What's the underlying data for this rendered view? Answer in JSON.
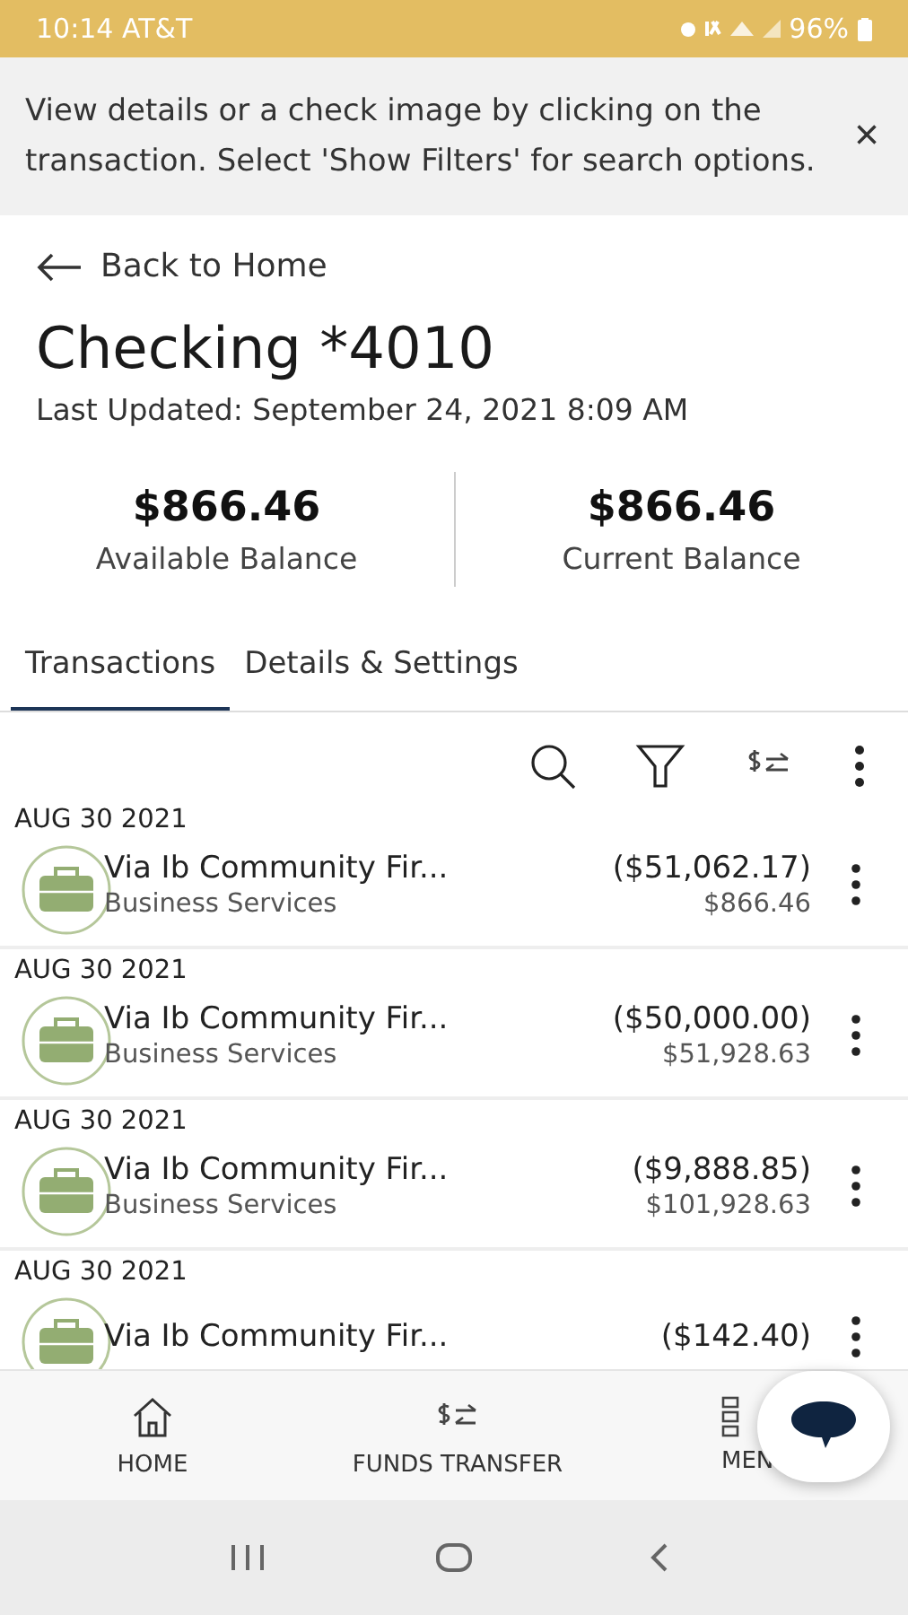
{
  "status_bar": {
    "time": "10:14 AT&T",
    "battery": "96%"
  },
  "banner": {
    "text": "View details or a check image by clicking on the transaction. Select 'Show Filters' for search options.",
    "close": "×"
  },
  "back": {
    "label": "Back to Home"
  },
  "account": {
    "title": "Checking *4010",
    "updated": "Last Updated: September 24, 2021 8:09 AM"
  },
  "balances": [
    {
      "amount": "$866.46",
      "label": "Available Balance"
    },
    {
      "amount": "$866.46",
      "label": "Current Balance"
    }
  ],
  "tabs": [
    {
      "label": "Transactions",
      "selected": true
    },
    {
      "label": "Details & Settings",
      "selected": false
    }
  ],
  "transactions": [
    {
      "date": "AUG 30 2021",
      "name": "Via Ib Community Fir...",
      "amount": "($51,062.17)",
      "category": "Business Services",
      "balance": "$866.46"
    },
    {
      "date": "AUG 30 2021",
      "name": "Via Ib Community Fir...",
      "amount": "($50,000.00)",
      "category": "Business Services",
      "balance": "$51,928.63"
    },
    {
      "date": "AUG 30 2021",
      "name": "Via Ib Community Fir...",
      "amount": "($9,888.85)",
      "category": "Business Services",
      "balance": "$101,928.63"
    },
    {
      "date": "AUG 30 2021",
      "name": "Via Ib Community Fir...",
      "amount": "($142.40)"
    }
  ],
  "bottom_nav": [
    {
      "label": "HOME",
      "kind": "home"
    },
    {
      "label": "FUNDS TRANSFER",
      "kind": "transfer"
    },
    {
      "label": "MEN",
      "kind": "menu"
    }
  ]
}
